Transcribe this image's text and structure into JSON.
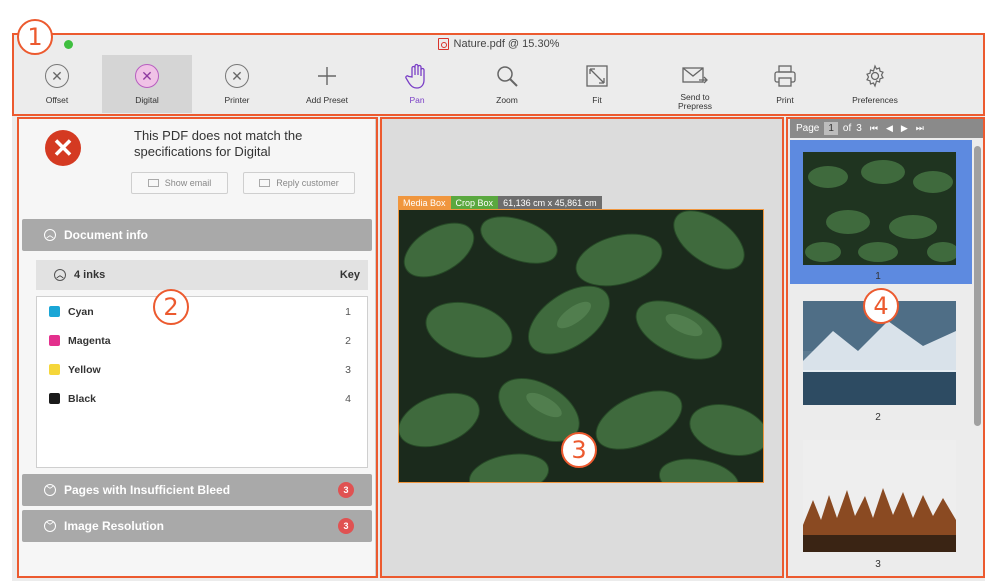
{
  "window": {
    "title": "Nature.pdf @ 15.30%"
  },
  "toolbar": {
    "items": [
      {
        "label": "Offset",
        "icon": "circle-x-icon"
      },
      {
        "label": "Digital",
        "icon": "circle-x-pink-icon",
        "active": true
      },
      {
        "label": "Printer",
        "icon": "circle-x-icon"
      },
      {
        "label": "Add Preset",
        "icon": "plus-icon"
      },
      {
        "label": "Pan",
        "icon": "hand-icon"
      },
      {
        "label": "Zoom",
        "icon": "magnifier-icon"
      },
      {
        "label": "Fit",
        "icon": "fit-icon"
      },
      {
        "label": "Send to\nPrepress",
        "icon": "send-envelope-icon"
      },
      {
        "label": "Print",
        "icon": "printer-icon"
      },
      {
        "label": "Preferences",
        "icon": "gear-icon"
      }
    ]
  },
  "left_panel": {
    "error_message": "This PDF does not match the specifications for Digital",
    "show_email": "Show email",
    "reply_customer": "Reply customer",
    "document_info": "Document info",
    "inks_header": "4 inks",
    "key_header": "Key",
    "inks": [
      {
        "name": "Cyan",
        "key": "1",
        "color": "#1aa6d6"
      },
      {
        "name": "Magenta",
        "key": "2",
        "color": "#e3308d"
      },
      {
        "name": "Yellow",
        "key": "3",
        "color": "#f5d63a"
      },
      {
        "name": "Black",
        "key": "4",
        "color": "#1a1a1a"
      }
    ],
    "bleed_section": "Pages with Insufficient Bleed",
    "bleed_count": "3",
    "resolution_section": "Image Resolution",
    "resolution_count": "3"
  },
  "preview": {
    "media_box": "Media Box",
    "crop_box": "Crop Box",
    "dimensions": "61,136 cm x 45,861 cm"
  },
  "pager": {
    "page_label": "Page",
    "current": "1",
    "of_label": "of",
    "total": "3"
  },
  "thumbnails": [
    {
      "label": "1"
    },
    {
      "label": "2"
    },
    {
      "label": "3"
    }
  ],
  "callouts": [
    "1",
    "2",
    "3",
    "4"
  ],
  "colors": {
    "accent_orange": "#ec5a2f",
    "error_red": "#d43a22",
    "selection_blue": "#5d8ae0",
    "media_box_tag": "#f0963e",
    "crop_box_tag": "#5aa83f",
    "dims_tag": "#6d6d6d"
  }
}
